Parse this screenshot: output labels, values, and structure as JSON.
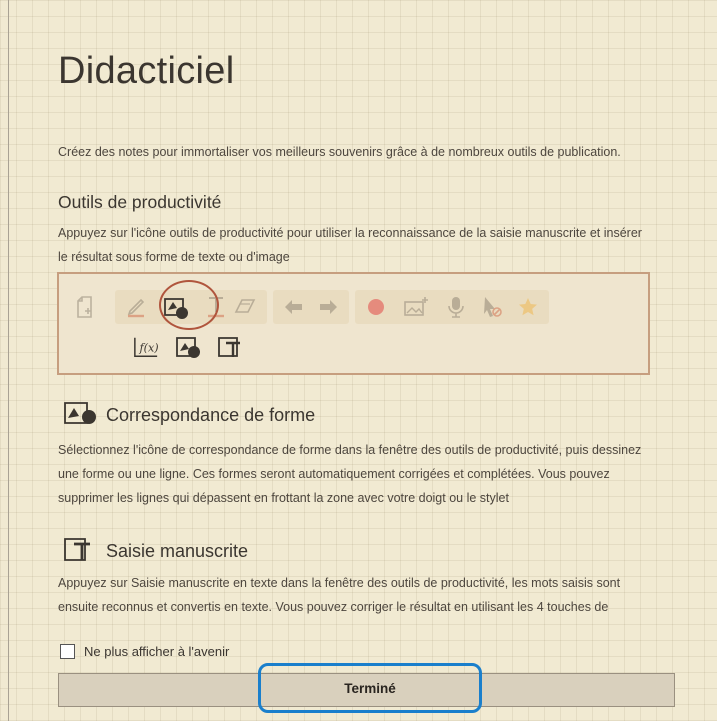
{
  "page": {
    "title": "Didacticiel",
    "intro": "Créez des notes pour immortaliser vos meilleurs souvenirs grâce à de nombreux outils de publication."
  },
  "productivity": {
    "heading": "Outils de productivité",
    "description_line1": "Appuyez sur l'icône outils de productivité pour utiliser la reconnaissance de la saisie manuscrite et insérer",
    "description_line2": "le résultat sous forme de texte ou d'image",
    "toolbar_icons": [
      "page-add-icon",
      "pen-icon",
      "shape-match-icon",
      "text-icon",
      "eraser-icon",
      "undo-icon",
      "redo-icon",
      "record-icon",
      "image-add-icon",
      "microphone-icon",
      "touch-disable-icon",
      "star-icon"
    ],
    "sub_icons": [
      "formula-icon",
      "shape-match-icon",
      "handwriting-text-icon"
    ],
    "highlight_color": "#b0553d"
  },
  "shape_section": {
    "title": "Correspondance de forme",
    "line1": "Sélectionnez l'icône de correspondance de forme dans la fenêtre des outils de productivité, puis dessinez",
    "line2": "une forme ou une ligne. Ces formes seront automatiquement corrigées et complétées. Vous pouvez",
    "line3": "supprimer les lignes qui dépassent en frottant la zone avec votre doigt ou le stylet"
  },
  "handwriting_section": {
    "title": "Saisie manuscrite",
    "line1": "Appuyez sur Saisie manuscrite en texte dans la fenêtre des outils de productivité, les mots saisis sont",
    "line2": "ensuite reconnus et convertis en texte. Vous pouvez corriger le résultat en utilisant les 4 touches de"
  },
  "footer": {
    "checkbox_label": "Ne plus afficher à l'avenir",
    "checkbox_checked": false,
    "done_label": "Terminé",
    "done_highlight_color": "#1a7fcc"
  }
}
